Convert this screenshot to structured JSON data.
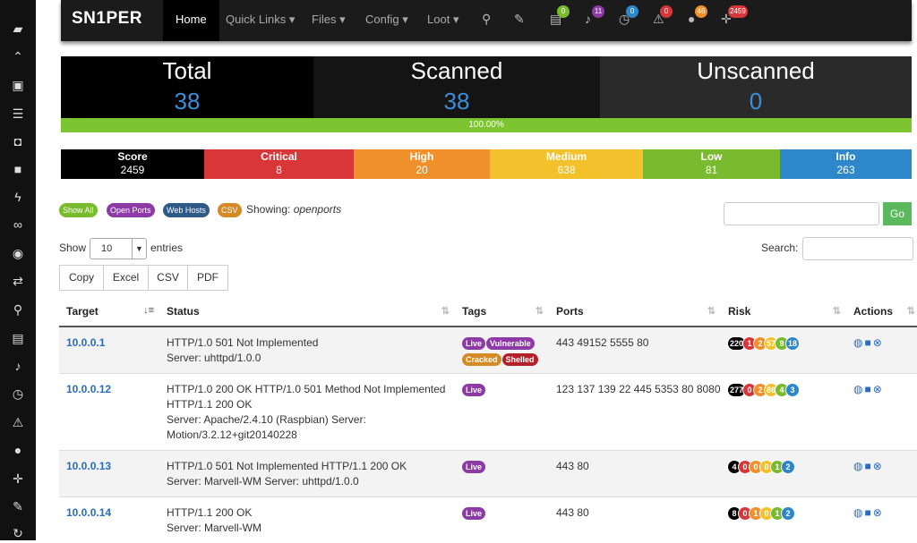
{
  "colors": {
    "critical": "#d9363a",
    "high": "#f0902b",
    "medium": "#f3c12b",
    "low": "#79ba2e",
    "info": "#2e86cb",
    "score": "#000000",
    "tag_live": "#8e3aa6",
    "tag_vulnerable": "#8e3aa6",
    "tag_cracked": "#d58a25",
    "tag_shelled": "#b4202a"
  },
  "sidebar": {
    "icons": [
      "folders-icon",
      "chevron-up-icon",
      "image-icon",
      "list-icon",
      "bucket-icon",
      "lock-icon",
      "bolt-icon",
      "glasses-icon",
      "target-icon",
      "arrows-exchange-icon",
      "search-icon",
      "document-icon",
      "bell-icon",
      "clock-icon",
      "warning-icon",
      "user-icon",
      "crosshair-icon",
      "edit-icon",
      "refresh-icon"
    ]
  },
  "nav": {
    "brand": "SN1PER",
    "home": "Home",
    "quick_links": "Quick Links",
    "files": "Files",
    "config": "Config",
    "loot": "Loot",
    "badges": {
      "docs": "0",
      "notifications": "11",
      "timer": "0",
      "alerts": "0",
      "users": "46",
      "crosshair": "2459"
    }
  },
  "stats": {
    "total_label": "Total",
    "total": "38",
    "scanned_label": "Scanned",
    "scanned": "38",
    "unscanned_label": "Unscanned",
    "unscanned": "0",
    "progress": "100.00%"
  },
  "risk": {
    "score_label": "Score",
    "score": "2459",
    "critical_label": "Critical",
    "critical": "8",
    "high_label": "High",
    "high": "20",
    "medium_label": "Medium",
    "medium": "638",
    "low_label": "Low",
    "low": "81",
    "info_label": "Info",
    "info": "263"
  },
  "filters": {
    "show_all": "Show All",
    "open_ports": "Open Ports",
    "web_hosts": "Web Hosts",
    "csv": "CSV",
    "showing_label": "Showing:",
    "showing_value": "openports",
    "go": "Go"
  },
  "table_controls": {
    "show": "Show",
    "length": "10",
    "entries": "entries",
    "search": "Search:",
    "copy": "Copy",
    "excel": "Excel",
    "csv": "CSV",
    "pdf": "PDF"
  },
  "table": {
    "headers": {
      "target": "Target",
      "status": "Status",
      "tags": "Tags",
      "ports": "Ports",
      "risk": "Risk",
      "actions": "Actions"
    },
    "rows": [
      {
        "target": "10.0.0.1",
        "status1": "HTTP/1.0 501 Not Implemented",
        "status2": "Server: uhttpd/1.0.0",
        "status3": "",
        "ports": "443 49152 5555 80",
        "tags": [
          "Live",
          "Vulnerable",
          "Cracked",
          "Shelled"
        ],
        "risk": {
          "score": "220",
          "critical": "1",
          "high": "2",
          "medium": "57",
          "low": "9",
          "info": "18"
        }
      },
      {
        "target": "10.0.0.12",
        "status1": "HTTP/1.0 200 OK HTTP/1.0 501 Method Not Implemented HTTP/1.1 200 OK",
        "status2": "Server: Apache/2.4.10 (Raspbian) Server: Motion/3.2.12+git20140228",
        "status3": "",
        "ports": "123 137 139 22 445 5353 80 8080",
        "tags": [
          "Live"
        ],
        "risk": {
          "score": "277",
          "critical": "0",
          "high": "2",
          "medium": "86",
          "low": "4",
          "info": "3"
        }
      },
      {
        "target": "10.0.0.13",
        "status1": "HTTP/1.0 501 Not Implemented HTTP/1.1 200 OK",
        "status2": "Server: Marvell-WM Server: uhttpd/1.0.0",
        "status3": "",
        "ports": "443 80",
        "tags": [
          "Live"
        ],
        "risk": {
          "score": "4",
          "critical": "0",
          "high": "0",
          "medium": "0",
          "low": "1",
          "info": "2"
        }
      },
      {
        "target": "10.0.0.14",
        "status1": "HTTP/1.1 200 OK",
        "status2": "Server: Marvell-WM",
        "status3": "",
        "ports": "443 80",
        "tags": [
          "Live"
        ],
        "risk": {
          "score": "8",
          "critical": "0",
          "high": "1",
          "medium": "0",
          "low": "1",
          "info": "2"
        }
      }
    ]
  }
}
